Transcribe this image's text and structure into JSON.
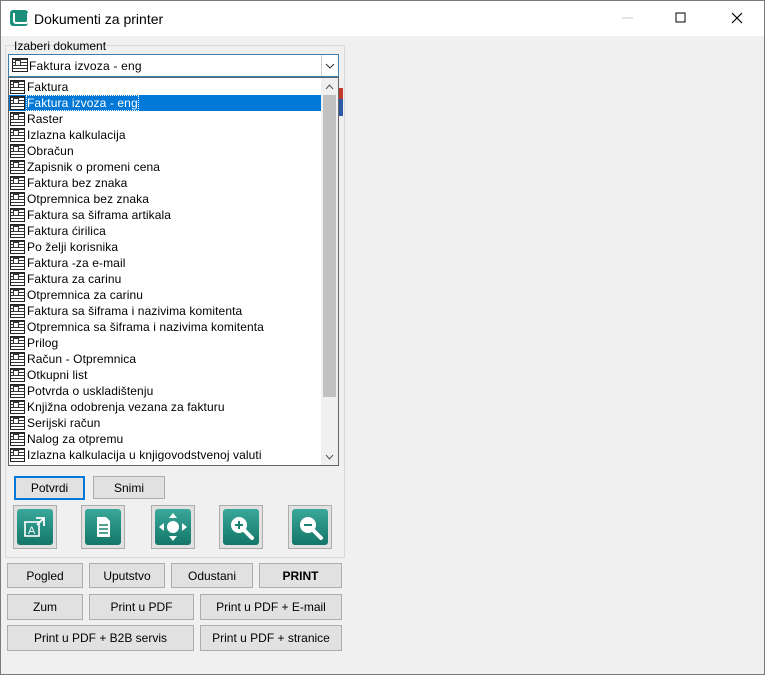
{
  "window": {
    "title": "Dokumenti za printer"
  },
  "select_group": {
    "label": "Izaberi dokument",
    "selected": "Faktura izvoza - eng"
  },
  "dropdown": {
    "items": [
      "Faktura",
      "Faktura izvoza - eng",
      "Raster",
      "Izlazna kalkulacija",
      "Obračun",
      "Zapisnik o promeni cena",
      "Faktura bez znaka",
      "Otpremnica bez znaka",
      "Faktura sa šiframa artikala",
      "Faktura ćirilica",
      "Po želji korisnika",
      "Faktura -za e-mail",
      "Faktura za carinu",
      "Otpremnica za carinu",
      "Faktura sa šiframa i nazivima komitenta",
      "Otpremnica sa šiframa i nazivima komitenta",
      "Prilog",
      "Račun - Otpremnica",
      "Otkupni list",
      "Potvrda o uskladištenju",
      "Knjižna odobrenja vezana za fakturu",
      "Serijski račun",
      "Nalog za otpremu",
      "Izlazna kalkulacija u knjigovodstvenoj valuti"
    ],
    "selected_index": 1
  },
  "buttons": {
    "potvrdi": "Potvrdi",
    "snimi": "Snimi",
    "pogled": "Pogled",
    "uputstvo": "Uputstvo",
    "odustani": "Odustani",
    "print": "PRINT",
    "zum": "Zum",
    "print_pdf": "Print u PDF",
    "print_pdf_email": "Print u PDF + E-mail",
    "print_pdf_b2b": "Print u PDF + B2B servis",
    "print_pdf_stranice": "Print u PDF + stranice"
  },
  "toolbar": {
    "icons": [
      "export-icon",
      "document-icon",
      "pan-icon",
      "zoom-in-icon",
      "zoom-out-icon"
    ]
  },
  "colors": {
    "accent": "#0078d7",
    "tool_icon": "#1f8b7c"
  }
}
